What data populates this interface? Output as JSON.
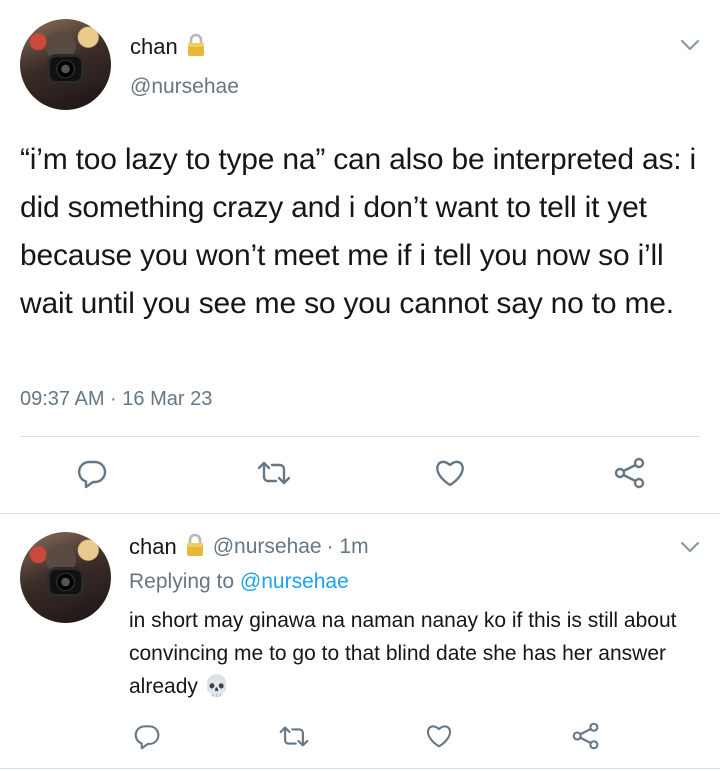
{
  "main_tweet": {
    "display_name": "chan",
    "handle": "@nursehae",
    "text": "“i’m too lazy to type na” can also be interpreted as: i did something crazy and i don’t want to tell it yet because you won’t meet me if i tell you now so i’ll wait until you see me so you cannot say no to me.",
    "timestamp": "09:37 AM · 16 Mar 23"
  },
  "reply_tweet": {
    "display_name": "chan",
    "handle": "@nursehae",
    "time_ago": "· 1m",
    "replying_prefix": "Replying to",
    "replying_handle": "@nursehae",
    "text": "in short may ginawa na naman nanay ko if this is still about convincing me to go to that blind date she has her answer already",
    "emoji": "💀"
  },
  "icons": {
    "reply": "reply-icon",
    "retweet": "retweet-icon",
    "like": "like-icon",
    "share": "share-icon",
    "lock": "lock-icon",
    "more": "chevron-down-icon"
  },
  "colors": {
    "text": "#14171a",
    "secondary": "#657786",
    "link": "#1da1f2",
    "divider": "#d9e0e5"
  }
}
